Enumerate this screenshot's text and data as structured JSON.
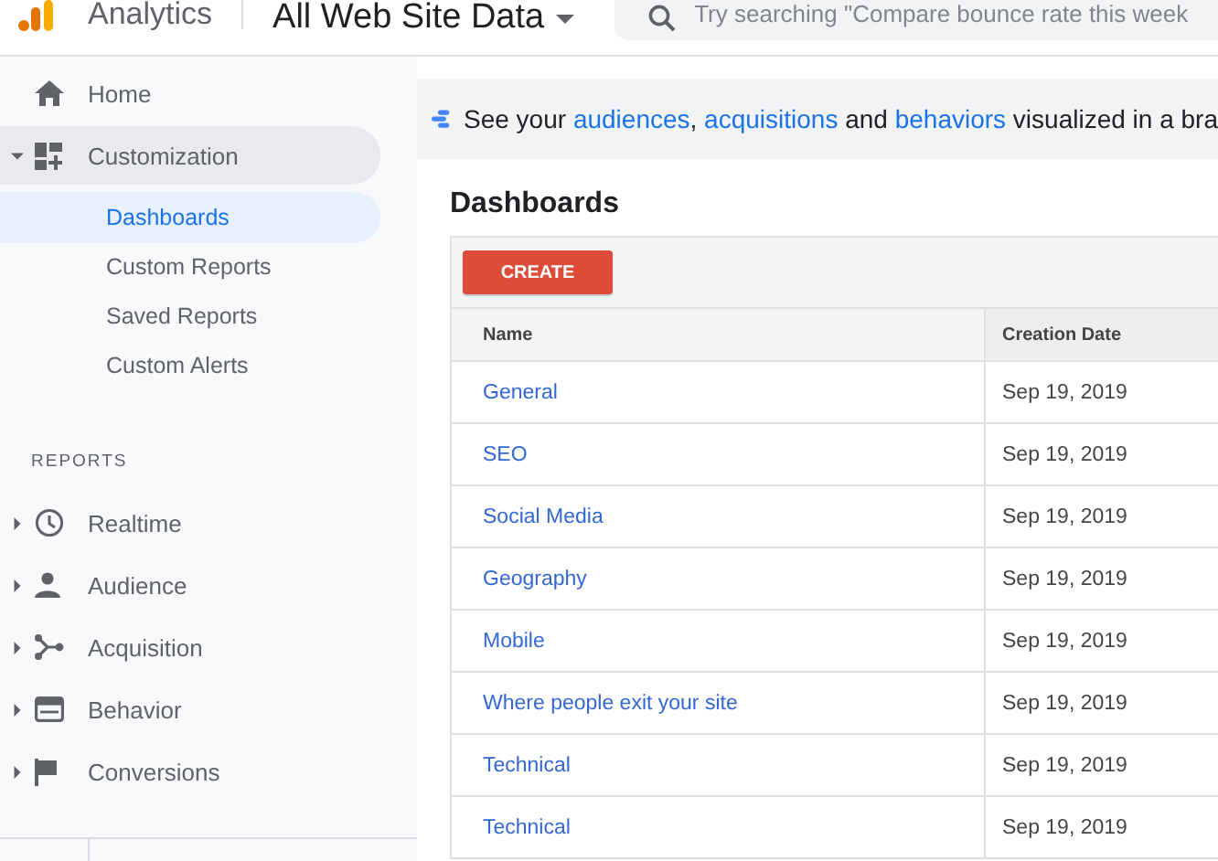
{
  "header": {
    "app_name": "Analytics",
    "property": "All Web Site Data",
    "search": {
      "placeholder": "Try searching \"Compare bounce rate this week"
    }
  },
  "sidebar": {
    "items": [
      {
        "label": "Home",
        "expanded": false
      },
      {
        "label": "Customization",
        "expanded": true,
        "children": [
          {
            "label": "Dashboards",
            "selected": true
          },
          {
            "label": "Custom Reports",
            "selected": false
          },
          {
            "label": "Saved Reports",
            "selected": false
          },
          {
            "label": "Custom Alerts",
            "selected": false
          }
        ]
      }
    ],
    "section_title": "REPORTS",
    "reports": [
      {
        "label": "Realtime",
        "expanded": false
      },
      {
        "label": "Audience",
        "expanded": false
      },
      {
        "label": "Acquisition",
        "expanded": false
      },
      {
        "label": "Behavior",
        "expanded": false
      },
      {
        "label": "Conversions",
        "expanded": false
      }
    ]
  },
  "banner": {
    "links": [
      {
        "before": "See your ",
        "link": "audiences"
      },
      {
        "before": ", ",
        "link": "acquisitions"
      },
      {
        "before": " and ",
        "link": "behaviors"
      }
    ],
    "after": " visualized in a bra"
  },
  "page_title": "Dashboards",
  "create_button": "CREATE",
  "table": {
    "columns": [
      "Name",
      "Creation Date"
    ],
    "rows": [
      {
        "name": "General",
        "date": "Sep 19, 2019"
      },
      {
        "name": "SEO",
        "date": "Sep 19, 2019"
      },
      {
        "name": "Social Media",
        "date": "Sep 19, 2019"
      },
      {
        "name": "Geography",
        "date": "Sep 19, 2019"
      },
      {
        "name": "Mobile",
        "date": "Sep 19, 2019"
      },
      {
        "name": "Where people exit your site",
        "date": "Sep 19, 2019"
      },
      {
        "name": "Technical",
        "date": "Sep 19, 2019"
      },
      {
        "name": "Technical",
        "date": "Sep 19, 2019"
      }
    ]
  }
}
